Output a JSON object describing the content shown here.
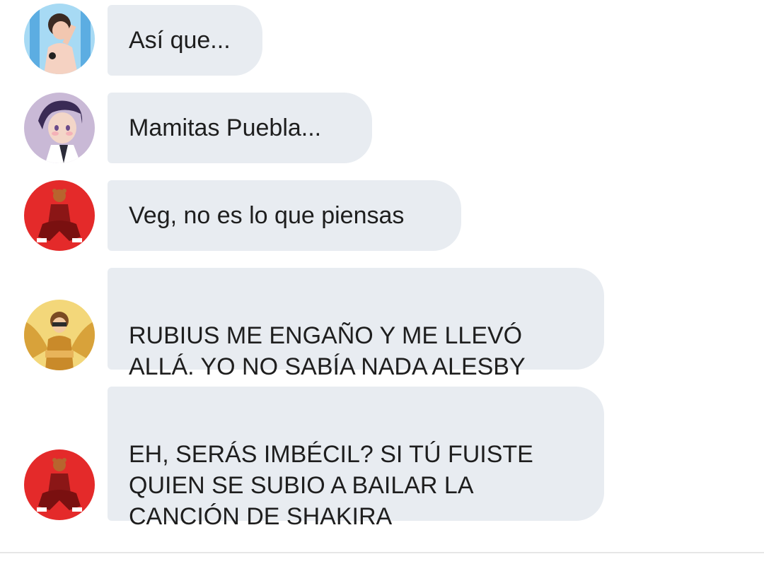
{
  "messages": [
    {
      "avatar": "avatar-blue-character",
      "text": "Así que..."
    },
    {
      "avatar": "avatar-purple-hair-character",
      "text": "Mamitas Puebla..."
    },
    {
      "avatar": "avatar-red-bear-character",
      "text": "Veg, no es lo que piensas"
    },
    {
      "avatar": "avatar-golden-wings-character",
      "text": "RUBIUS ME ENGAÑO Y ME LLEVÓ\nALLÁ. YO NO SABÍA NADA ALESBY"
    },
    {
      "avatar": "avatar-red-bear-character",
      "text": "EH, SERÁS IMBÉCIL? SI TÚ FUISTE\nQUIEN SE SUBIO A BAILAR LA\nCANCIÓN DE SHAKIRA"
    }
  ],
  "colors": {
    "bubble": "#e8ecf1",
    "text": "#1e1e1e",
    "background": "#ffffff"
  }
}
